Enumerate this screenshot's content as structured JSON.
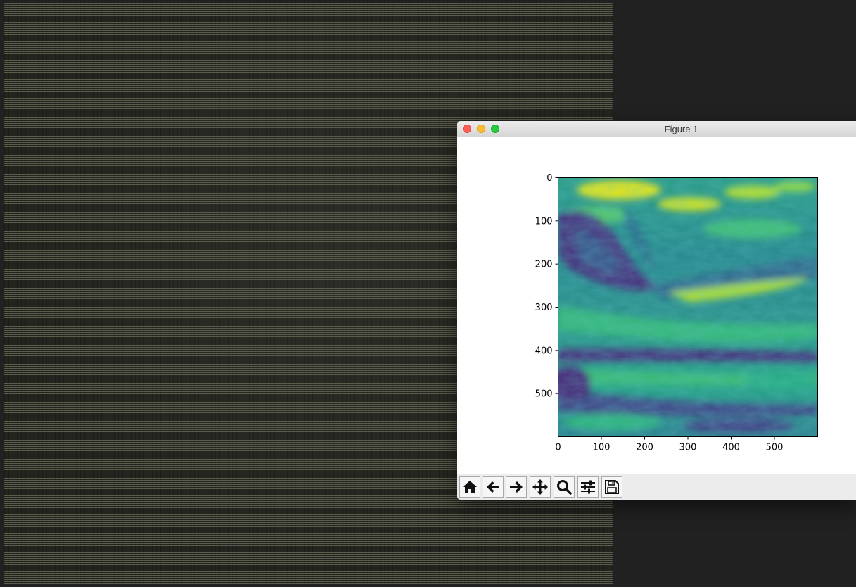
{
  "window": {
    "title": "Figure 1"
  },
  "plot": {
    "colormap": "viridis",
    "image_content": "ocean wave photograph",
    "x_ticks": [
      "0",
      "100",
      "200",
      "300",
      "400",
      "500"
    ],
    "y_ticks": [
      "0",
      "100",
      "200",
      "300",
      "400",
      "500"
    ]
  },
  "chart_data": {
    "type": "heatmap",
    "colormap": "viridis",
    "xlim": [
      0,
      600
    ],
    "ylim": [
      600,
      0
    ],
    "x_tick_values": [
      0,
      100,
      200,
      300,
      400,
      500
    ],
    "y_tick_values": [
      0,
      100,
      200,
      300,
      400,
      500
    ]
  },
  "toolbar": {
    "buttons": [
      {
        "name": "home-button",
        "icon": "home-icon"
      },
      {
        "name": "back-button",
        "icon": "arrow-left-icon"
      },
      {
        "name": "forward-button",
        "icon": "arrow-right-icon"
      },
      {
        "name": "pan-button",
        "icon": "move-icon"
      },
      {
        "name": "zoom-button",
        "icon": "magnifier-icon"
      },
      {
        "name": "configure-subplots-button",
        "icon": "sliders-icon"
      },
      {
        "name": "save-button",
        "icon": "floppy-disk-icon"
      }
    ]
  }
}
